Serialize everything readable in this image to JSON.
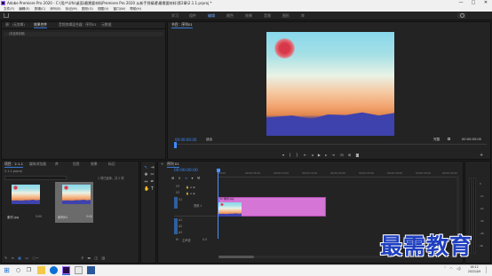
{
  "window": {
    "title": "Adobe Premiere Pro 2020 - C:\\用户\\Ufo\\桌面\\最需要材料Premiere Pro 2020 从新手到精通\\最需要材料\\第2章\\2.1.1.prproj *",
    "minimize": "—",
    "maximize": "□",
    "close": "✕"
  },
  "menu": [
    "文件(F)",
    "编辑(E)",
    "剪辑(C)",
    "序列(S)",
    "标记(M)",
    "图形(G)",
    "视图(V)",
    "窗口(W)",
    "帮助(H)"
  ],
  "workspaces": [
    "学习",
    "组件",
    "编辑",
    "颜色",
    "效果",
    "音频",
    "图形",
    "库"
  ],
  "active_workspace": "编辑",
  "source_panel": {
    "tabs": [
      "源：(无剪辑)",
      "效果控件",
      "音频剪辑混合器：序列01",
      "元数据"
    ],
    "active_tab": "效果控件",
    "empty_text": "（未选择剪辑）"
  },
  "program_panel": {
    "tab": "节目：序列01",
    "timecode_left": "00:00:00:00",
    "fit": "适合",
    "quality": "完整",
    "timecode_right": "00:00:05:00"
  },
  "project_panel": {
    "tabs": [
      "项目：2.1.1",
      "媒体浏览器",
      "库",
      "信息",
      "效果",
      "标记"
    ],
    "active_tab": "项目：2.1.1",
    "path": "2.1.1.prproj",
    "items_count": "1 项已选择，共 2 项",
    "items": [
      {
        "name": "素材.jpg",
        "duration": "5:00"
      },
      {
        "name": "序列01",
        "duration": "5:00"
      }
    ]
  },
  "timeline": {
    "tab": "序列 01",
    "timecode": "00:00:00:00",
    "ruler": [
      "00:00",
      "00:00:05:00",
      "00:00:10:00",
      "00:00:15:00",
      "00:00:20:00",
      "00:00:25:00",
      "00:00:30:00",
      "00:00:35:00",
      "00:00:40:00"
    ],
    "tracks": [
      {
        "id": "V3",
        "name": ""
      },
      {
        "id": "V2",
        "name": ""
      },
      {
        "id": "V1",
        "name": "视频 1"
      },
      {
        "id": "A1",
        "name": ""
      },
      {
        "id": "A2",
        "name": ""
      },
      {
        "id": "A3",
        "name": ""
      },
      {
        "id": "M",
        "name": "主声道"
      }
    ],
    "master_value": "0.0",
    "clip_label": "fx 素材.jpg"
  },
  "meters": {
    "labels": [
      "0",
      "-12",
      "-24",
      "-36",
      "-48",
      "dB"
    ]
  },
  "taskbar": {
    "time": "16:12",
    "date": "2022/4/9"
  },
  "watermark": "最需教育"
}
